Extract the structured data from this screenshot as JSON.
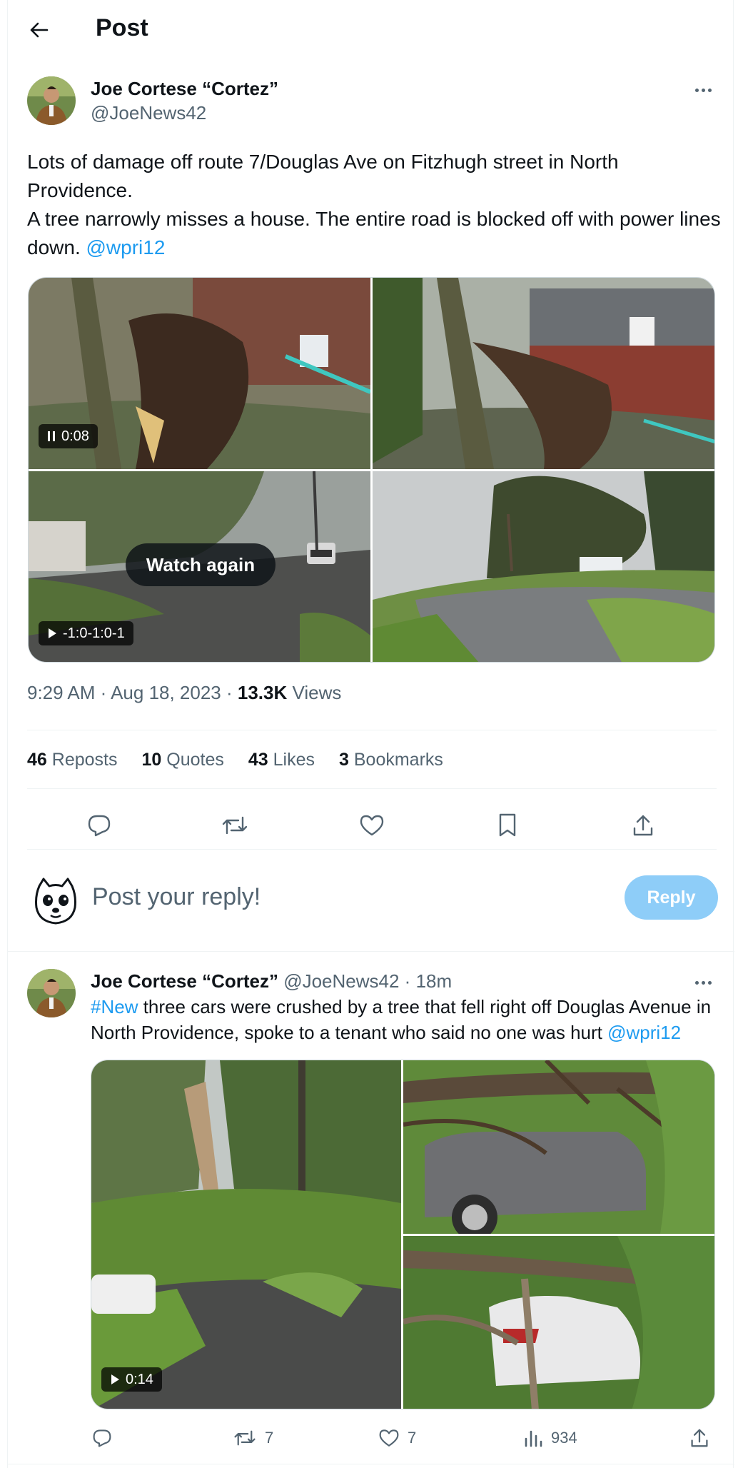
{
  "header": {
    "title": "Post"
  },
  "main_post": {
    "author_name": "Joe Cortese “Cortez”",
    "author_handle": "@JoeNews42",
    "text": "Lots of damage off route 7/Douglas Ave on Fitzhugh street in North Providence.\nA tree narrowly misses a house. The entire road is blocked off with power lines down. ",
    "mention": "@wpri12",
    "media": {
      "video1_time": "0:08",
      "video2_time": "-1:0-1:0-1",
      "watch_again_label": "Watch again"
    },
    "time": "9:29 AM",
    "date": "Aug 18, 2023",
    "views_count": "13.3K",
    "views_label": "Views",
    "stats": [
      {
        "count": "46",
        "label": "Reposts"
      },
      {
        "count": "10",
        "label": "Quotes"
      },
      {
        "count": "43",
        "label": "Likes"
      },
      {
        "count": "3",
        "label": "Bookmarks"
      }
    ]
  },
  "composer": {
    "placeholder": "Post your reply!",
    "reply_label": "Reply"
  },
  "second_post": {
    "author_name": "Joe Cortese “Cortez”",
    "author_handle": "@JoeNews42",
    "age": "18m",
    "hashtag": "#New",
    "text": " three cars were crushed by a tree that fell right off Douglas Avenue in North Providence, spoke to a tenant who said no one was hurt ",
    "mention": "@wpri12",
    "video_time": "0:14",
    "reposts": "7",
    "likes": "7",
    "views": "934"
  },
  "colors": {
    "accent": "#1d9bf0",
    "reply_button": "#8ecdf8",
    "muted_text": "#536471"
  },
  "icons": [
    "back-arrow-icon",
    "more-icon",
    "reply-icon",
    "repost-icon",
    "like-icon",
    "bookmark-icon",
    "share-icon",
    "views-icon",
    "pause-icon",
    "play-icon"
  ]
}
